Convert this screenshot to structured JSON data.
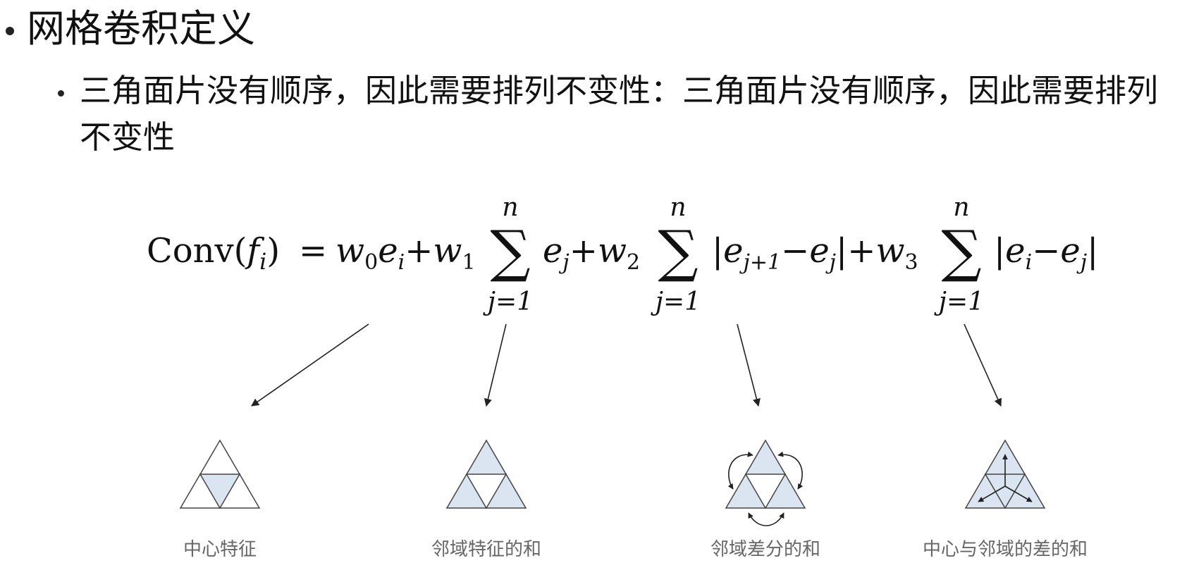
{
  "heading": "网格卷积定义",
  "subheading": "三角面片没有顺序，因此需要排列不变性：三角面片没有顺序，因此需要排列不变性",
  "formula": {
    "lhs": "Conv(",
    "f": "f",
    "i": "i",
    "close_paren": ")",
    "eq": "=",
    "w0": "w",
    "sub0": "0",
    "e": "e",
    "plus": "+",
    "w1": "w",
    "sub1": "1",
    "w2": "w",
    "sub2": "2",
    "w3": "w",
    "sub3": "3",
    "j": "j",
    "j1": "j+1",
    "minus": "−",
    "bar": "|",
    "sum": "∑",
    "upper": "n",
    "lower": "j=1"
  },
  "captions": [
    "中心特征",
    "邻域特征的和",
    "邻域差分的和",
    "中心与邻域的差的和"
  ],
  "colors": {
    "fill": "#dbe5f1",
    "stroke": "#444444",
    "caption": "#666666"
  }
}
